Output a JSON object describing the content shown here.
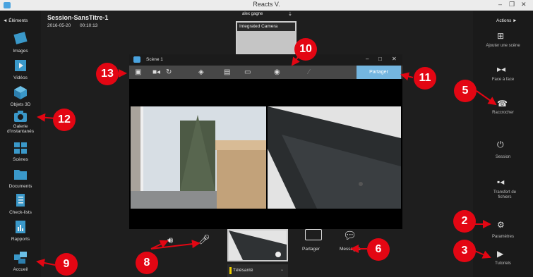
{
  "window": {
    "title": "Reacts V.",
    "controls": [
      "–",
      "❐",
      "✕"
    ]
  },
  "left_panel": {
    "header": "◄ Éléments",
    "items": [
      {
        "label": "Images",
        "icon": "images-icon"
      },
      {
        "label": "Vidéos",
        "icon": "videos-icon"
      },
      {
        "label": "Objets 3D",
        "icon": "objects-3d-icon"
      },
      {
        "label": "Galerie d'instantanés",
        "icon": "camera-icon"
      },
      {
        "label": "Scènes",
        "icon": "scenes-icon"
      },
      {
        "label": "Documents",
        "icon": "folder-icon"
      },
      {
        "label": "Check-lists",
        "icon": "checklist-icon"
      },
      {
        "label": "Rapports",
        "icon": "reports-icon"
      },
      {
        "label": "Accueil",
        "icon": "home-icon"
      }
    ]
  },
  "session": {
    "name": "Session-SansTitre-1",
    "date": "2016-05-20",
    "time": "00:10:13"
  },
  "camera": {
    "user": "alex gagne",
    "label": "Integrated Camera"
  },
  "scene_window": {
    "title": "Scène 1",
    "share_label": "Partager",
    "controls": [
      "–",
      "□",
      "✕"
    ]
  },
  "right_panel": {
    "header": "Actions ►",
    "items": [
      {
        "label": "Ajouter une scène"
      },
      {
        "label": "Face à face"
      },
      {
        "label": "Raccrocher"
      },
      {
        "label": "Session"
      },
      {
        "label": "Transfert de fichiers"
      },
      {
        "label": "Paramètres"
      },
      {
        "label": "Tutoriels"
      }
    ]
  },
  "bottom": {
    "share": "Partager",
    "messages": "Messages",
    "telesante": "Télésanté"
  },
  "badges": [
    "13",
    "10",
    "11",
    "12",
    "5",
    "2",
    "3",
    "6",
    "8",
    "9"
  ],
  "accent": "#e30613"
}
